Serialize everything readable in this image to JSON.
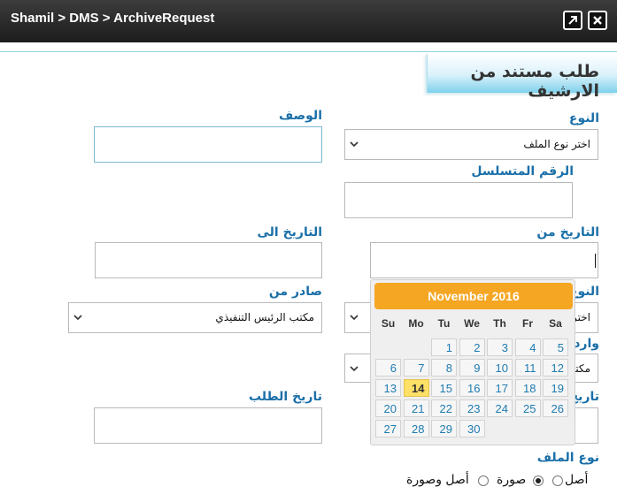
{
  "window": {
    "breadcrumb": "Shamil > DMS > ArchiveRequest",
    "icons": [
      "expand-icon",
      "close-icon"
    ]
  },
  "page": {
    "title": "طلب مستند من الارشيف"
  },
  "form": {
    "type_label": "النوع",
    "type_value": "اختر نوع الملف",
    "description_label": "الوصف",
    "serial_label": "الرقم المتسلسل",
    "date_from_label": "التاريخ من",
    "date_to_label": "التاريخ الى",
    "type2_label_partial": "النوع",
    "type2_value_partial": "اختر",
    "issued_from_label": "صادر من",
    "issued_from_value": "مكتب الرئيس التنفيذي",
    "incoming_label_partial": "وارد",
    "incoming_value_partial": "مكتب",
    "request_date_label": "تاريخ الطلب",
    "date_label_partial": "تاريخ",
    "file_type_label": "نوع الملف",
    "file_type_options": [
      "أصل",
      "صورة",
      "أصل وصورة"
    ],
    "file_type_selected": "صورة"
  },
  "calendar": {
    "month_title": "November 2016",
    "weekdays": [
      "Su",
      "Mo",
      "Tu",
      "We",
      "Th",
      "Fr",
      "Sa"
    ],
    "first_weekday": 2,
    "days_in_month": 30,
    "today": 14
  },
  "colors": {
    "label_blue": "#1a6fa8",
    "calendar_header": "#f5a623",
    "today_highlight": "#ffe066",
    "titlebar": "#2a2a2a"
  }
}
